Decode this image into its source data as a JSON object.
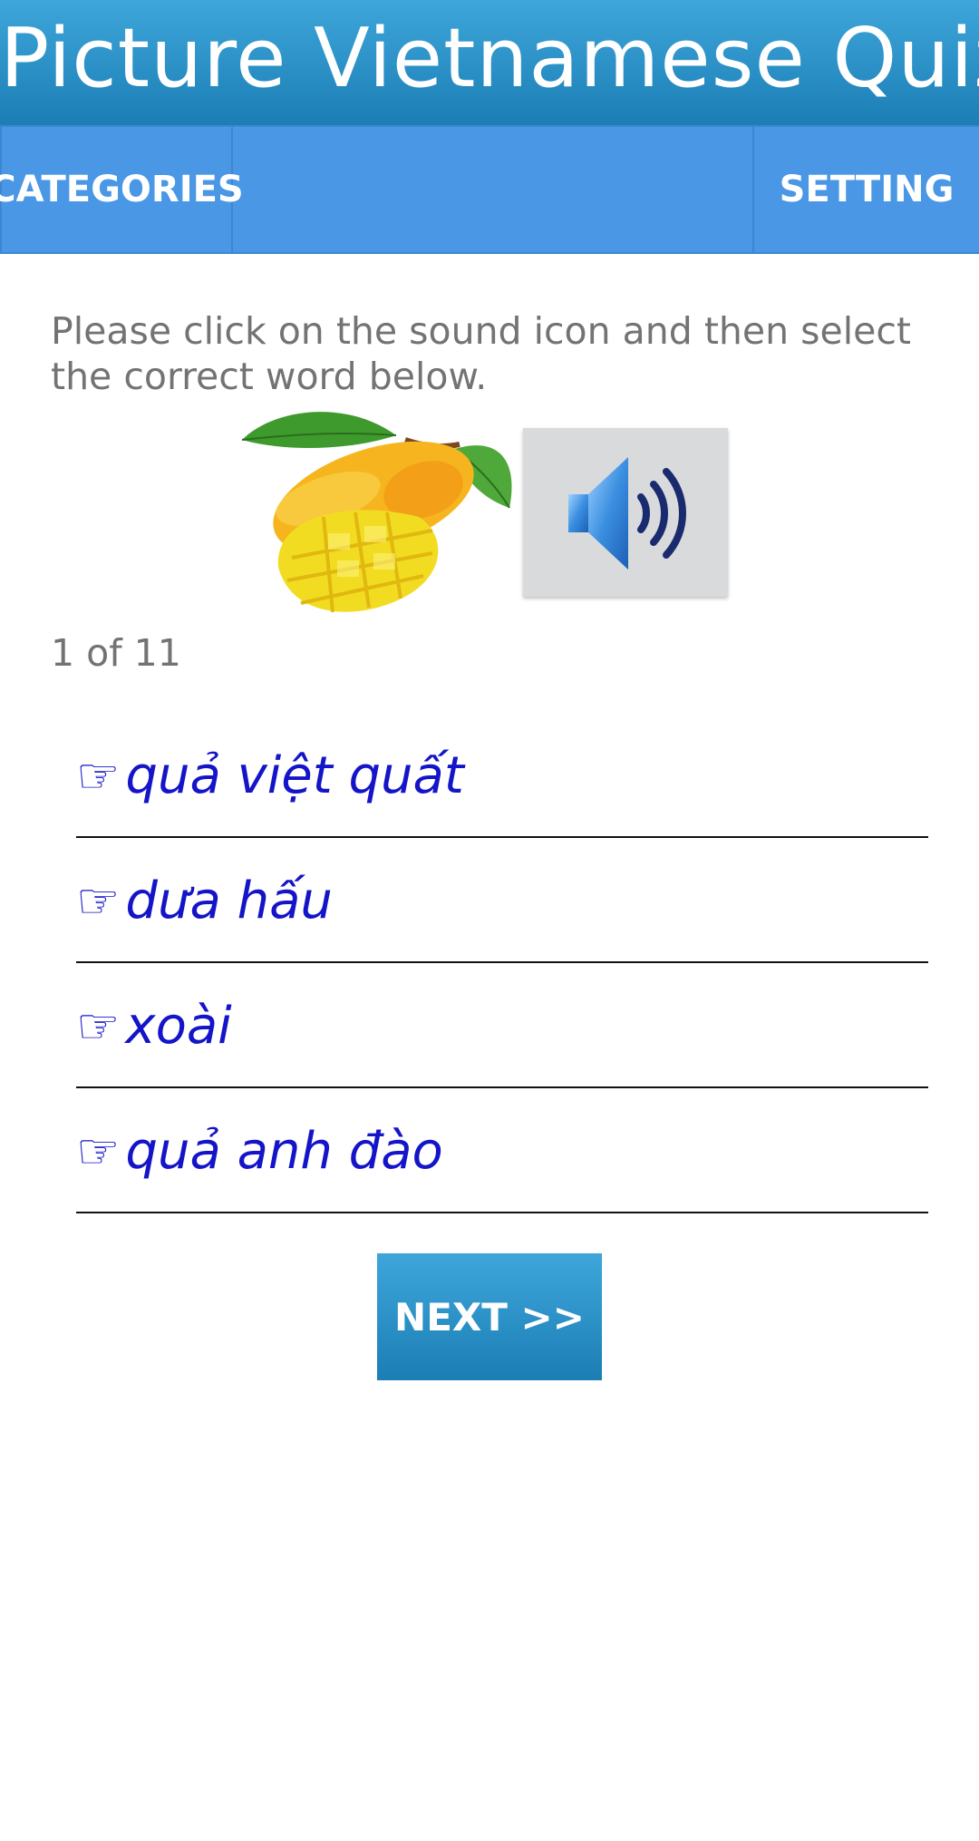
{
  "header": {
    "title": "Picture Vietnamese Quiz"
  },
  "nav": {
    "categories_label": "CATEGORIES",
    "setting_label": "SETTING"
  },
  "quiz": {
    "instructions": "Please click on the sound icon and then select the correct word below.",
    "picture_icon": "mango-picture",
    "sound_icon": "speaker-icon",
    "progress": "1 of 11",
    "answers": [
      {
        "hand": "☞",
        "text": "quả việt quất"
      },
      {
        "hand": "☞",
        "text": "dưa hấu"
      },
      {
        "hand": "☞",
        "text": "xoài"
      },
      {
        "hand": "☞",
        "text": "quả anh đào"
      }
    ],
    "next_label": "NEXT >>"
  },
  "colors": {
    "header_top": "#3ea6da",
    "header_bottom": "#1b7eb5",
    "nav_bg": "#4a97e5",
    "answer_text": "#1414c8",
    "muted_text": "#737373"
  }
}
